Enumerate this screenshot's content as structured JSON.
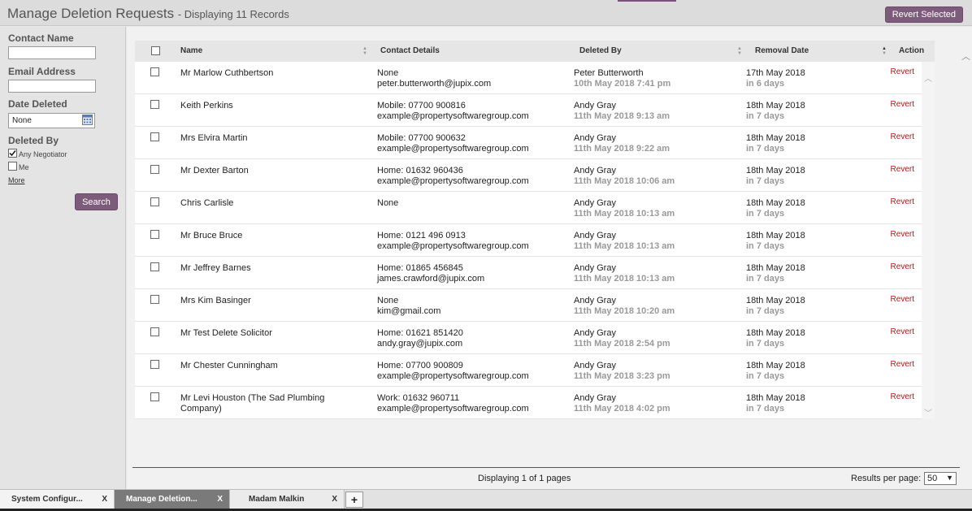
{
  "header": {
    "title": "Manage Deletion Requests",
    "subtitle": "- Displaying 11 Records",
    "revert_selected": "Revert Selected"
  },
  "sidebar": {
    "contact_name_label": "Contact Name",
    "email_label": "Email Address",
    "date_deleted_label": "Date Deleted",
    "date_deleted_value": "None",
    "deleted_by_label": "Deleted By",
    "opt_any": "Any Negotiator",
    "opt_any_checked": true,
    "opt_me": "Me",
    "more": "More",
    "search": "Search"
  },
  "table": {
    "headers": {
      "name": "Name",
      "contact": "Contact Details",
      "deleted_by": "Deleted By",
      "removal": "Removal Date",
      "action": "Action"
    },
    "rows": [
      {
        "name": "Mr Marlow Cuthbertson",
        "contact1": "None",
        "contact2": "peter.butterworth@jupix.com",
        "by": "Peter Butterworth",
        "by_date": "10th May 2018 7:41 pm",
        "removal": "17th May 2018",
        "removal_in": "in 6 days",
        "action": "Revert"
      },
      {
        "name": "Keith Perkins",
        "contact1": "Mobile: 07700 900816",
        "contact2": "example@propertysoftwaregroup.com",
        "by": "Andy Gray",
        "by_date": "11th May 2018 9:13 am",
        "removal": "18th May 2018",
        "removal_in": "in 7 days",
        "action": "Revert"
      },
      {
        "name": "Mrs Elvira Martin",
        "contact1": "Mobile: 07700 900632",
        "contact2": "example@propertysoftwaregroup.com",
        "by": "Andy Gray",
        "by_date": "11th May 2018 9:22 am",
        "removal": "18th May 2018",
        "removal_in": "in 7 days",
        "action": "Revert"
      },
      {
        "name": "Mr Dexter Barton",
        "contact1": "Home: 01632 960436",
        "contact2": "example@propertysoftwaregroup.com",
        "by": "Andy Gray",
        "by_date": "11th May 2018 10:06 am",
        "removal": "18th May 2018",
        "removal_in": "in 7 days",
        "action": "Revert"
      },
      {
        "name": "Chris Carlisle",
        "contact1": "None",
        "contact2": "",
        "by": "Andy Gray",
        "by_date": "11th May 2018 10:13 am",
        "removal": "18th May 2018",
        "removal_in": "in 7 days",
        "action": "Revert"
      },
      {
        "name": "Mr Bruce Bruce",
        "contact1": "Home: 0121 496 0913",
        "contact2": "example@propertysoftwaregroup.com",
        "by": "Andy Gray",
        "by_date": "11th May 2018 10:13 am",
        "removal": "18th May 2018",
        "removal_in": "in 7 days",
        "action": "Revert"
      },
      {
        "name": "Mr Jeffrey Barnes",
        "contact1": "Home: 01865 456845",
        "contact2": "james.crawford@jupix.com",
        "by": "Andy Gray",
        "by_date": "11th May 2018 10:13 am",
        "removal": "18th May 2018",
        "removal_in": "in 7 days",
        "action": "Revert"
      },
      {
        "name": "Mrs Kim Basinger",
        "contact1": "None",
        "contact2": "kim@gmail.com",
        "by": "Andy Gray",
        "by_date": "11th May 2018 10:20 am",
        "removal": "18th May 2018",
        "removal_in": "in 7 days",
        "action": "Revert"
      },
      {
        "name": "Mr Test Delete Solicitor",
        "contact1": "Home: 01621 851420",
        "contact2": "andy.gray@jupix.com",
        "by": "Andy Gray",
        "by_date": "11th May 2018 2:54 pm",
        "removal": "18th May 2018",
        "removal_in": "in 7 days",
        "action": "Revert"
      },
      {
        "name": "Mr Chester Cunningham",
        "contact1": "Home: 07700 900809",
        "contact2": "example@propertysoftwaregroup.com",
        "by": "Andy Gray",
        "by_date": "11th May 2018 3:23 pm",
        "removal": "18th May 2018",
        "removal_in": "in 7 days",
        "action": "Revert"
      },
      {
        "name": "Mr Levi Houston (The Sad Plumbing Company)",
        "contact1": "Work: 01632 960711",
        "contact2": "example@propertysoftwaregroup.com",
        "by": "Andy Gray",
        "by_date": "11th May 2018 4:02 pm",
        "removal": "18th May 2018",
        "removal_in": "in 7 days",
        "action": "Revert"
      }
    ]
  },
  "footer": {
    "pages": "Displaying 1 of 1 pages",
    "rpp_label": "Results per page:",
    "rpp_value": "50"
  },
  "tabs": [
    {
      "label": "System Configur...",
      "close": "X",
      "active": false
    },
    {
      "label": "Manage Deletion...",
      "close": "X",
      "active": true
    },
    {
      "label": "Madam Malkin",
      "close": "X",
      "active": false
    }
  ],
  "tab_add": "+",
  "colors": {
    "accent": "#7d5b7b",
    "revert": "#b01818"
  }
}
